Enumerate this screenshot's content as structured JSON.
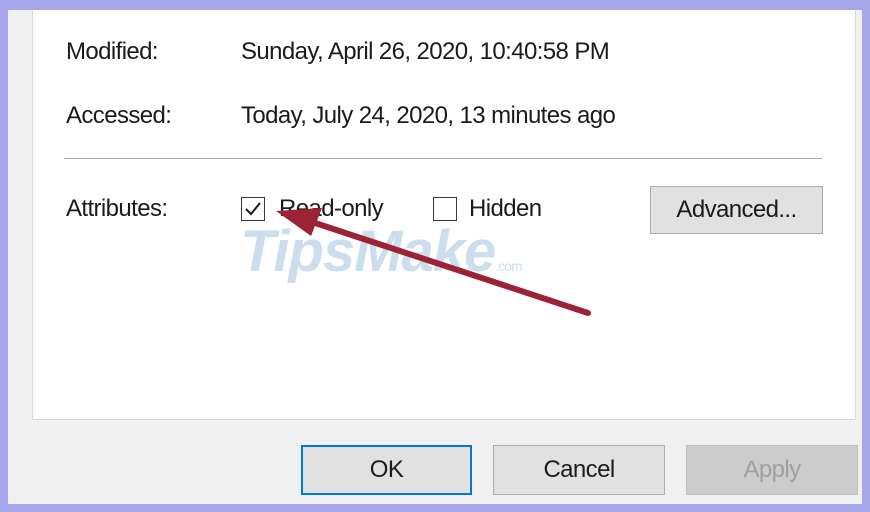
{
  "details": {
    "modified_label": "Modified:",
    "modified_value": "Sunday, April 26, 2020, 10:40:58 PM",
    "accessed_label": "Accessed:",
    "accessed_value": "Today, July 24, 2020, 13 minutes ago"
  },
  "attributes": {
    "label": "Attributes:",
    "readonly_label": "Read-only",
    "readonly_checked": true,
    "hidden_label": "Hidden",
    "hidden_checked": false,
    "advanced_label": "Advanced..."
  },
  "footer": {
    "ok_label": "OK",
    "cancel_label": "Cancel",
    "apply_label": "Apply"
  },
  "watermark": {
    "text": "TipsMake",
    "suffix": ".com"
  },
  "colors": {
    "frame": "#a7a6ea",
    "accent": "#0078d7",
    "arrow": "#9b2335"
  }
}
